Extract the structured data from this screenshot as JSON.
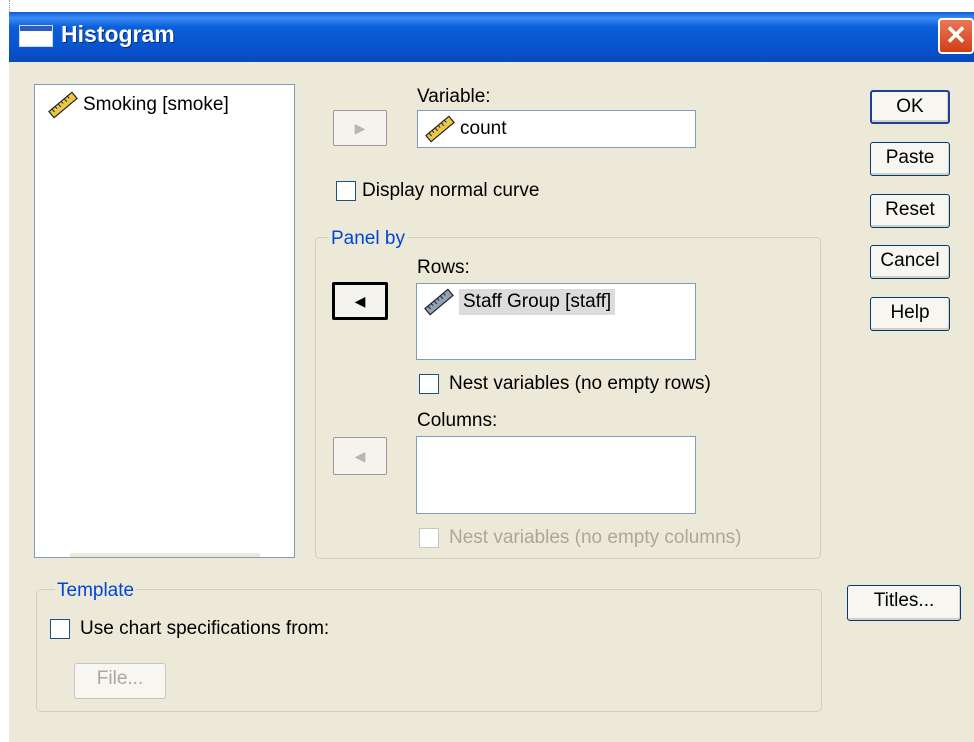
{
  "window": {
    "title": "Histogram",
    "close_glyph": "✕"
  },
  "source_list": {
    "items": [
      {
        "label": "Smoking [smoke]",
        "icon": "scale-ruler-icon"
      }
    ]
  },
  "variable": {
    "label": "Variable:",
    "value": "count",
    "icon": "scale-ruler-icon"
  },
  "normal_curve": {
    "label": "Display normal curve",
    "checked": false
  },
  "panel_by": {
    "title": "Panel by",
    "rows_label": "Rows:",
    "rows_items": [
      {
        "label": "Staff Group [staff]",
        "icon": "scale-ruler-icon",
        "selected": true
      }
    ],
    "nest_rows_label": "Nest variables (no empty rows)",
    "columns_label": "Columns:",
    "columns_items": [],
    "nest_columns_label": "Nest variables (no empty columns)"
  },
  "template": {
    "title": "Template",
    "use_spec_label": "Use chart specifications from:",
    "file_button": "File..."
  },
  "buttons": {
    "ok": "OK",
    "paste": "Paste",
    "reset": "Reset",
    "cancel": "Cancel",
    "help": "Help",
    "titles": "Titles..."
  },
  "arrow_glyphs": {
    "right": "▶",
    "left": "◀"
  },
  "colors": {
    "titlebar": "#0a55d0",
    "dialog_bg": "#ece9d8",
    "group_title": "#0046d5",
    "disabled_text": "#aca899"
  }
}
